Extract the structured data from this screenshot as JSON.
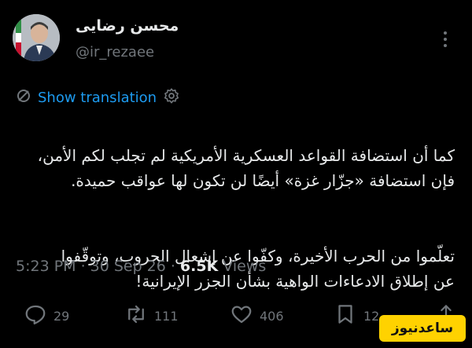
{
  "author": {
    "display_name": "محسن رضایی",
    "handle": "@ir_rezaee"
  },
  "translation": {
    "label": "Show translation"
  },
  "tweet": {
    "paragraph1": "كما أن استضافة القواعد العسكرية الأمريكية لم تجلب لكم الأمن،\nفإن استضافة «جزّار غزة» أيضًا لن تكون لها عواقب حميدة.",
    "paragraph2": "تعلّموا من الحرب الأخيرة، وكفّوا عن إشعال الحروب، وتوقّفوا\nعن إطلاق الادعاءات الواهية بشأن الجزر الإيرانية!"
  },
  "meta": {
    "time": "5:23 PM",
    "separator": "·",
    "date": "30 Sep 26",
    "views_count": "6.5K",
    "views_label": "Views"
  },
  "actions": {
    "replies": "29",
    "reposts": "111",
    "likes": "406",
    "bookmarks": "12"
  },
  "watermark": {
    "text": "ساعدنیوز"
  },
  "colors": {
    "background": "#000000",
    "text": "#e7e9ea",
    "muted": "#71767b",
    "link": "#1d9bf0",
    "watermark_bg": "#ffd200"
  }
}
